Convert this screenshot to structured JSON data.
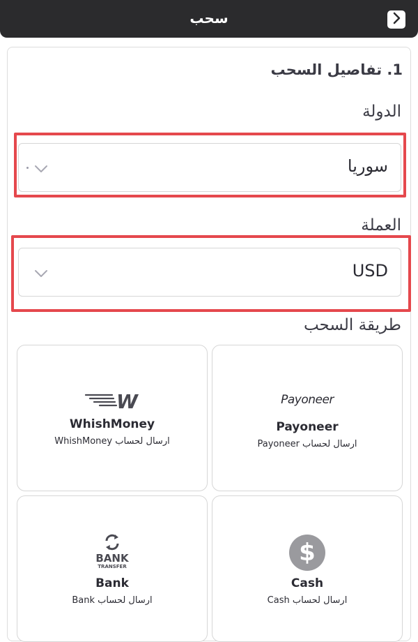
{
  "header": {
    "title": "سحب",
    "back_icon": "chevron-right-icon"
  },
  "section": {
    "title": "1. تفاصيل السحب"
  },
  "country": {
    "label": "الدولة",
    "value": "سوريا"
  },
  "currency": {
    "label": "العملة",
    "value": "USD"
  },
  "methods": {
    "label": "طريقة السحب",
    "items": [
      {
        "name": "Payoneer",
        "desc": "ارسال لحساب Payoneer",
        "logo_text": "Payoneer",
        "icon": "payoneer-logo-icon"
      },
      {
        "name": "WhishMoney",
        "desc": "ارسال لحساب WhishMoney",
        "logo_text": "W",
        "icon": "whishmoney-logo-icon"
      },
      {
        "name": "Cash",
        "desc": "ارسال لحساب Cash",
        "logo_text": "$",
        "icon": "dollar-coin-icon"
      },
      {
        "name": "Bank",
        "desc": "ارسال لحساب Bank",
        "logo_text": "BANK",
        "logo_subtext": "TRANSFER",
        "icon": "bank-transfer-icon"
      }
    ]
  },
  "colors": {
    "header_bg": "#2b2b2d",
    "highlight": "#e5484d",
    "border": "#d6d6d6"
  }
}
